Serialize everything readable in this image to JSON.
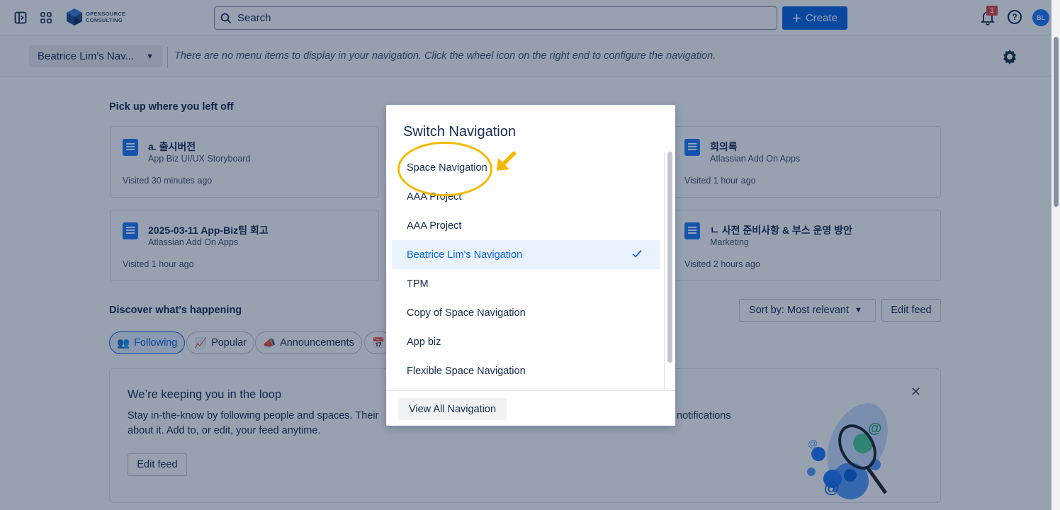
{
  "topbar": {
    "logo_line1": "OPENSOURCE",
    "logo_line2": "CONSULTING",
    "search_label": "Search",
    "create_label": "Create",
    "notification_count": "1",
    "help_glyph": "?",
    "avatar_initials": "BL"
  },
  "navbar": {
    "current_nav": "Beatrice Lim's Nav...",
    "empty_message": "There are no menu items to display in your navigation. Click the wheel icon on the right end to configure the navigation."
  },
  "recent": {
    "title": "Pick up where you left off",
    "cards": [
      {
        "title": "a. 출시버전",
        "space": "App Biz UI/UX Storyboard",
        "visited": "Visited 30 minutes ago"
      },
      {
        "title": "회의록",
        "space": "Atlassian Add On Apps",
        "visited": "Visited 1 hour ago"
      },
      {
        "title": "2025-03-11 App-Biz팀 회고",
        "space": "Atlassian Add On Apps",
        "visited": "Visited 1 hour ago"
      },
      {
        "title": "ㄴ 사전 준비사항 & 부스 운영 방안",
        "space": "Marketing",
        "visited": "Visited 2 hours ago"
      }
    ]
  },
  "discover": {
    "title": "Discover what's happening",
    "sort_label": "Sort by: Most relevant",
    "edit_feed": "Edit feed",
    "pills": [
      "Following",
      "Popular",
      "Announcements"
    ]
  },
  "loop_card": {
    "title": "We’re keeping you in the loop",
    "body_left": "Stay in-the-know by following people and spaces. Their",
    "body_right": "notifications",
    "body_line2": "about it. Add to, or edit, your feed anytime.",
    "edit_feed": "Edit feed"
  },
  "modal": {
    "title": "Switch Navigation",
    "items": [
      "Space Navigation",
      "AAA Project",
      "AAA Project",
      "Beatrice Lim's Navigation",
      "TPM",
      "Copy of Space Navigation",
      "App biz",
      "Flexible Space Navigation"
    ],
    "selected_index": 3,
    "view_all": "View All Navigation"
  },
  "colors": {
    "primary": "#0c66e4",
    "annotation": "#f5b800",
    "selected_bg": "#e9f2ff"
  }
}
